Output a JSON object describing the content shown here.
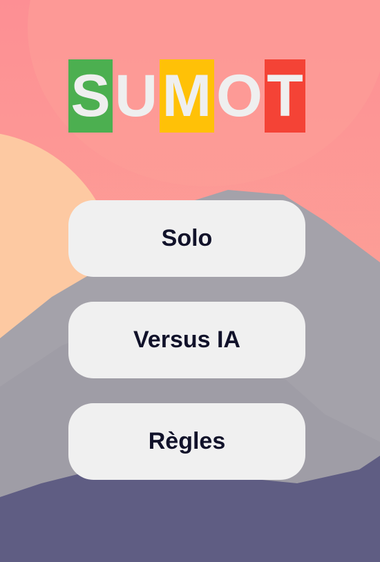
{
  "logo": {
    "letters": [
      {
        "char": "S",
        "bg": "#4caf50"
      },
      {
        "char": "U",
        "bg": ""
      },
      {
        "char": "M",
        "bg": "#ffc107"
      },
      {
        "char": "O",
        "bg": ""
      },
      {
        "char": "T",
        "bg": "#f44336"
      }
    ]
  },
  "menu": {
    "solo_label": "Solo",
    "versus_label": "Versus IA",
    "rules_label": "Règles"
  },
  "colors": {
    "sky_top": "#fd8f94",
    "sky_bottom": "#fcae98",
    "sun": "#fdc9a2",
    "mountain": "#a4a2aa",
    "ground": "#5f5d83",
    "button_bg": "#f0f0f0",
    "button_text": "#11122a"
  }
}
